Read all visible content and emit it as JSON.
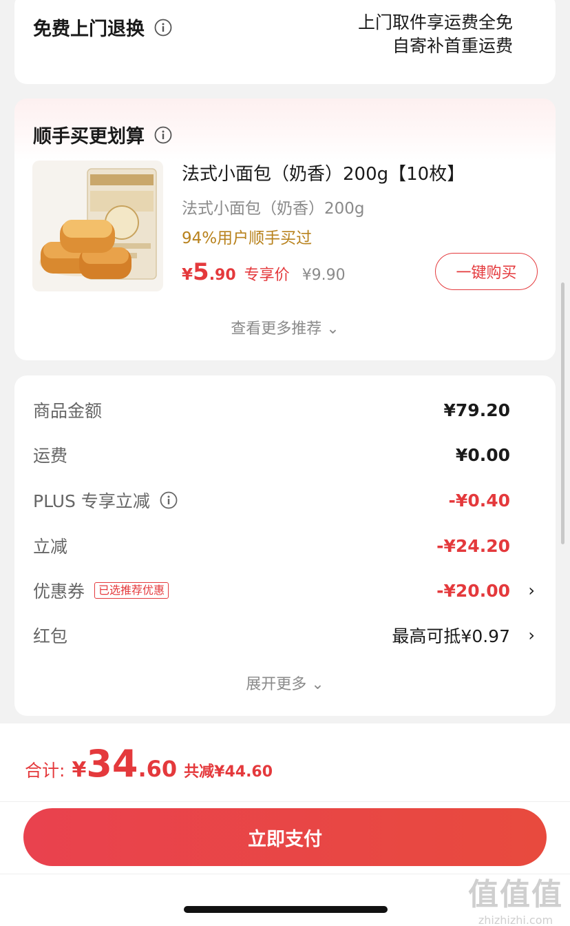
{
  "return_card": {
    "title": "免费上门退换",
    "desc_line1": "上门取件享运费全免",
    "desc_line2": "自寄补首重运费"
  },
  "bundle": {
    "title": "顺手买更划算",
    "product": {
      "name": "法式小面包（奶香）200g【10枚】",
      "subtitle": "法式小面包（奶香）200g",
      "tag": "94%用户顺手买过",
      "price_symbol": "¥",
      "price_int": "5",
      "price_dec": ".90",
      "price_label": "专享价",
      "original_price": "¥9.90"
    },
    "buy_button": "一键购买",
    "more_reco": "查看更多推荐 ⌄"
  },
  "summary": {
    "rows": [
      {
        "label": "商品金额",
        "value": "¥79.20"
      },
      {
        "label": "运费",
        "value": "¥0.00"
      },
      {
        "label": "PLUS 专享立减",
        "value": "-¥0.40"
      },
      {
        "label": "立减",
        "value": "-¥24.20"
      },
      {
        "label": "优惠券",
        "badge": "已选推荐优惠",
        "value": "-¥20.00"
      },
      {
        "label": "红包",
        "value": "最高可抵¥0.97"
      }
    ],
    "chevron": "›",
    "expand_more": "展开更多 ⌄"
  },
  "bottom": {
    "total_label": "合计:",
    "total_symbol": "¥",
    "total_int": "34",
    "total_dec": ".60",
    "total_saved": "共减¥44.60",
    "pay_button": "立即支付"
  },
  "watermark": {
    "glyphs": "值值值",
    "url": "zhizhizhi.com"
  },
  "colors": {
    "accent_red": "#e4393c",
    "tag_gold": "#b8821d",
    "muted_gray": "#8a8a8a"
  },
  "icons": {
    "info": "info-circle-icon",
    "chevron_right": "chevron-right-icon",
    "chevron_down": "chevron-down-icon"
  }
}
